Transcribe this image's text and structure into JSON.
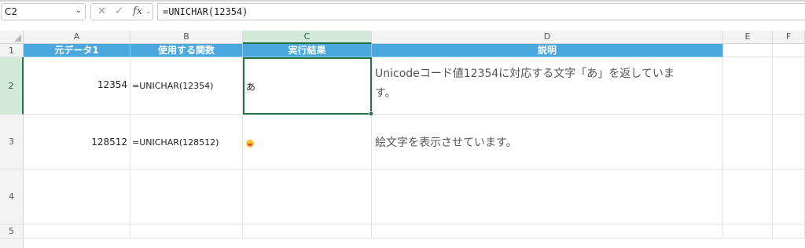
{
  "formula_bar": {
    "name_box": "C2",
    "name_box_dropdown_icon": "chevron-down-icon",
    "cancel_icon": "x-icon",
    "enter_icon": "check-icon",
    "fx_label": "fx",
    "formula": "=UNICHAR(12354)"
  },
  "columns": [
    "A",
    "B",
    "C",
    "D",
    "E",
    "F"
  ],
  "rows": [
    "1",
    "2",
    "3",
    "4",
    "5"
  ],
  "selected_cell": "C2",
  "header_fill": "#4aa8de",
  "selection_color": "#217346",
  "table": {
    "headers": [
      "元データ1",
      "使用する関数",
      "実行結果",
      "説明"
    ],
    "row2": {
      "a": "12354",
      "b": "=UNICHAR(12354)",
      "c": "あ",
      "d": "Unicodeコード値12354に対応する文字「あ」を返していま",
      "d_cont": "す。"
    },
    "row3": {
      "a": "128512",
      "b": "=UNICHAR(128512)",
      "c_icon": "grinning-face-emoji",
      "d": "絵文字を表示させています。"
    }
  }
}
